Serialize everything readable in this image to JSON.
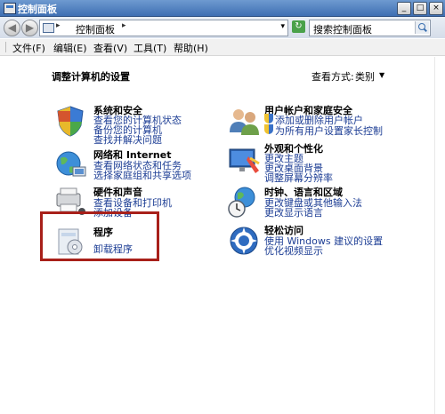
{
  "window": {
    "title": "控制面板",
    "min": "_",
    "max": "□",
    "close": "×"
  },
  "nav": {
    "back": "◀",
    "forward": "▶",
    "address_arrow": "▸",
    "address_text": "控制面板",
    "address_arrow2": "▸",
    "dropdown": "▾",
    "go": "↻",
    "search_placeholder": "搜索控制面板"
  },
  "menu": {
    "file": "文件(F)",
    "edit": "编辑(E)",
    "view": "查看(V)",
    "tools": "工具(T)",
    "help": "帮助(H)"
  },
  "main": {
    "heading": "调整计算机的设置",
    "view_label": "查看方式:",
    "view_value": "类别",
    "view_dropdown": "▼"
  },
  "categories": {
    "system": {
      "title": "系统和安全",
      "links": [
        "查看您的计算机状态",
        "备份您的计算机",
        "查找并解决问题"
      ]
    },
    "network": {
      "title": "网络和 Internet",
      "links": [
        "查看网络状态和任务",
        "选择家庭组和共享选项"
      ]
    },
    "hardware": {
      "title": "硬件和声音",
      "links": [
        "查看设备和打印机",
        "添加设备"
      ]
    },
    "programs": {
      "title": "程序",
      "links": [
        "卸载程序"
      ]
    },
    "users": {
      "title": "用户帐户和家庭安全",
      "links": [
        "添加或删除用户帐户",
        "为所有用户设置家长控制"
      ]
    },
    "appearance": {
      "title": "外观和个性化",
      "links": [
        "更改主题",
        "更改桌面背景",
        "调整屏幕分辨率"
      ]
    },
    "clock": {
      "title": "时钟、语言和区域",
      "links": [
        "更改键盘或其他输入法",
        "更改显示语言"
      ]
    },
    "ease": {
      "title": "轻松访问",
      "links": [
        "使用 Windows 建议的设置",
        "优化视频显示"
      ]
    }
  },
  "colors": {
    "link": "#1c3d94",
    "highlight_border": "#a8201a",
    "titlebar": "#3e6fb3"
  }
}
